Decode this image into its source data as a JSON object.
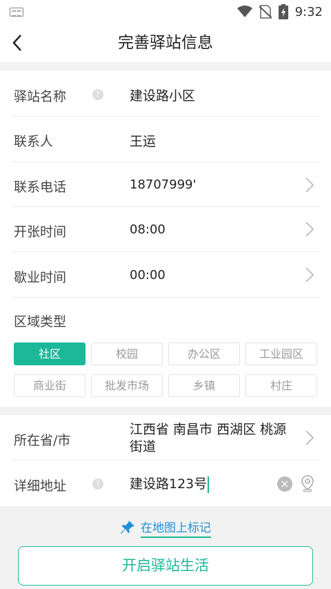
{
  "status_bar": {
    "time": "9:32",
    "icons": [
      "keyboard-icon",
      "wifi-icon",
      "no-sim-icon",
      "battery-charging-icon"
    ]
  },
  "header": {
    "back_icon": "chevron-left-icon",
    "title": "完善驿站信息"
  },
  "form": {
    "station_name": {
      "label": "驿站名称",
      "help": "?",
      "value": "建设路小区"
    },
    "contact": {
      "label": "联系人",
      "value": "王运"
    },
    "phone": {
      "label": "联系电话",
      "value": "18707999'"
    },
    "open_time": {
      "label": "开张时间",
      "value": "08:00"
    },
    "close_time": {
      "label": "歇业时间",
      "value": "00:00"
    },
    "area_type": {
      "label": "区域类型",
      "options": [
        "社区",
        "校园",
        "办公区",
        "工业园区",
        "商业街",
        "批发市场",
        "乡镇",
        "村庄"
      ],
      "selected": "社区"
    },
    "province": {
      "label": "所在省/市",
      "value_line1": "江西省 南昌市 西湖区 桃源",
      "value_line2": "街道"
    },
    "address": {
      "label": "详细地址",
      "help": "?",
      "value": "建设路123号",
      "clear": "×"
    }
  },
  "map_link": {
    "label": "在地图上标记",
    "icon": "pin-icon"
  },
  "submit": {
    "label": "开启驿站生活"
  },
  "colors": {
    "accent": "#1bb89a",
    "link": "#1f8fd6"
  }
}
